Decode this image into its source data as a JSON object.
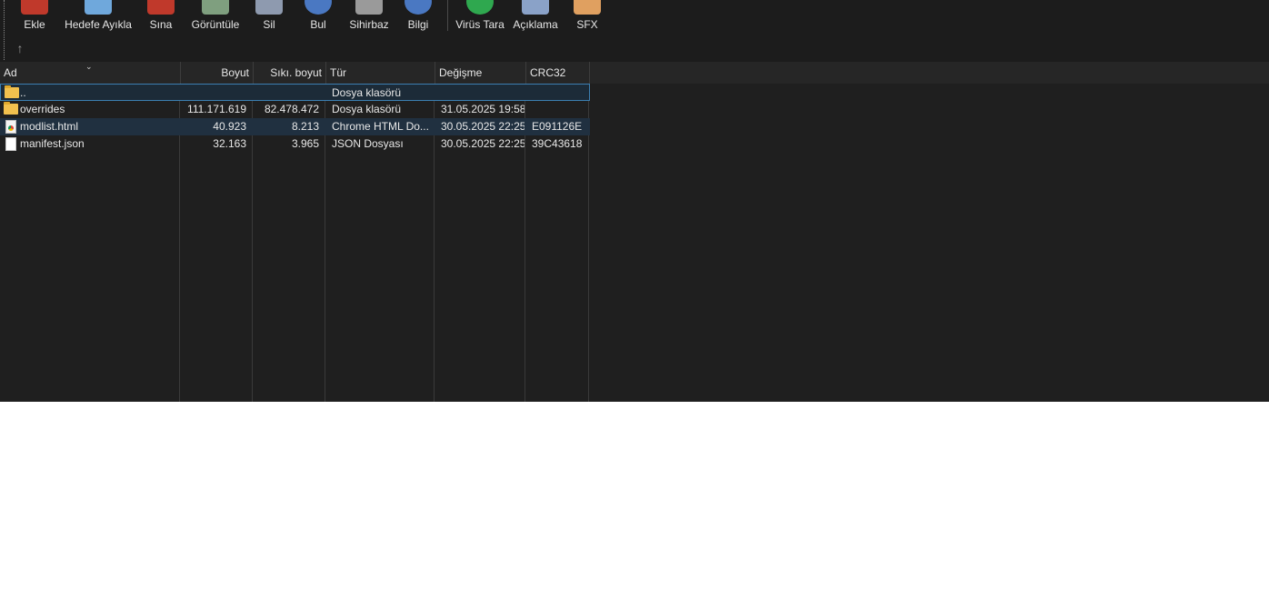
{
  "toolbar": {
    "buttons": [
      {
        "label": "Ekle",
        "icon": "add-archive-icon",
        "color": "#c0392b"
      },
      {
        "label": "Hedefe Ayıkla",
        "icon": "extract-to-icon",
        "color": "#6fa8dc"
      },
      {
        "label": "Sına",
        "icon": "test-icon",
        "color": "#c0392b"
      },
      {
        "label": "Görüntüle",
        "icon": "view-icon",
        "color": "#7f9f7f"
      },
      {
        "label": "Sil",
        "icon": "delete-icon",
        "color": "#8e9aaf"
      },
      {
        "label": "Bul",
        "icon": "find-icon",
        "color": "#4a78c2"
      },
      {
        "label": "Sihirbaz",
        "icon": "wizard-icon",
        "color": "#9a9a9a"
      },
      {
        "label": "Bilgi",
        "icon": "info-icon",
        "color": "#4a78c2"
      },
      {
        "label": "Virüs Tara",
        "icon": "virus-scan-icon",
        "color": "#2fa84f"
      },
      {
        "label": "Açıklama",
        "icon": "comment-icon",
        "color": "#8aa2c8"
      },
      {
        "label": "SFX",
        "icon": "sfx-icon",
        "color": "#e0a060"
      }
    ],
    "up_icon": "arrow-up-icon"
  },
  "columns": {
    "name": "Ad",
    "size": "Boyut",
    "packed": "Sıkı. boyut",
    "type": "Tür",
    "modified": "Değişme",
    "crc": "CRC32"
  },
  "rows": [
    {
      "name": "..",
      "size": "",
      "packed": "",
      "type": "Dosya klasörü",
      "modified": "",
      "crc": "",
      "icon": "folder-icon"
    },
    {
      "name": "overrides",
      "size": "111.171.619",
      "packed": "82.478.472",
      "type": "Dosya klasörü",
      "modified": "31.05.2025 19:58",
      "crc": "",
      "icon": "folder-icon"
    },
    {
      "name": "modlist.html",
      "size": "40.923",
      "packed": "8.213",
      "type": "Chrome HTML Do...",
      "modified": "30.05.2025 22:25",
      "crc": "E091126E",
      "icon": "chrome-html-file-icon"
    },
    {
      "name": "manifest.json",
      "size": "32.163",
      "packed": "3.965",
      "type": "JSON Dosyası",
      "modified": "30.05.2025 22:25",
      "crc": "39C43618",
      "icon": "json-file-icon"
    }
  ]
}
